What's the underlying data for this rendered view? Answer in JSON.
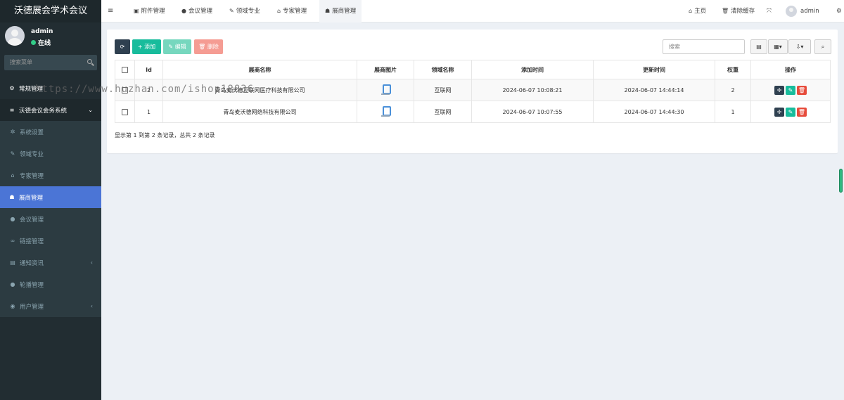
{
  "brand": {
    "title": "沃德展会学术会议"
  },
  "user": {
    "name": "admin",
    "status": "在线"
  },
  "sidebar": {
    "search_placeholder": "搜索菜单",
    "items": [
      {
        "label": "常规管理",
        "icon": "gears-icon",
        "glyph": "⚙",
        "type": "top",
        "arrow": ""
      },
      {
        "label": "沃德会议会务系统",
        "icon": "list-icon",
        "glyph": "≡",
        "type": "head",
        "arrow": "⌄"
      },
      {
        "label": "系统设置",
        "icon": "cog-icon",
        "glyph": "✲",
        "type": "sub",
        "arrow": ""
      },
      {
        "label": "领域专业",
        "icon": "pencil-icon",
        "glyph": "✎",
        "type": "sub",
        "arrow": ""
      },
      {
        "label": "专家管理",
        "icon": "graduation-cap-icon",
        "glyph": "⌂",
        "type": "sub",
        "arrow": ""
      },
      {
        "label": "展商管理",
        "icon": "users-icon",
        "glyph": "☗",
        "type": "active",
        "arrow": ""
      },
      {
        "label": "会议管理",
        "icon": "circle-icon",
        "glyph": "●",
        "type": "sub",
        "arrow": ""
      },
      {
        "label": "链接管理",
        "icon": "link-icon",
        "glyph": "∞",
        "type": "sub",
        "arrow": ""
      },
      {
        "label": "通知资讯",
        "icon": "newspaper-icon",
        "glyph": "▤",
        "type": "sub",
        "arrow": "‹"
      },
      {
        "label": "轮播管理",
        "icon": "circle-icon",
        "glyph": "●",
        "type": "sub",
        "arrow": ""
      },
      {
        "label": "用户管理",
        "icon": "user-circle-icon",
        "glyph": "◉",
        "type": "sub",
        "arrow": "‹"
      }
    ]
  },
  "topbar": {
    "menu_icon": "≡",
    "tabs": [
      {
        "label": "附件管理",
        "icon": "file-image-icon",
        "glyph": "▣"
      },
      {
        "label": "会议管理",
        "icon": "circle-icon",
        "glyph": "●"
      },
      {
        "label": "领域专业",
        "icon": "pencil-icon",
        "glyph": "✎"
      },
      {
        "label": "专家管理",
        "icon": "graduation-cap-icon",
        "glyph": "⌂"
      },
      {
        "label": "展商管理",
        "icon": "users-icon",
        "glyph": "☗"
      }
    ],
    "home": "主页",
    "clear_cache": "清除缓存",
    "user": "admin"
  },
  "toolbar": {
    "refresh": "⟳",
    "add": "添加",
    "edit": "编辑",
    "delete": "删除",
    "search_placeholder": "搜索",
    "colors": {
      "refresh": "#2f4050",
      "add": "#18bc9c",
      "edit": "#76d7be",
      "delete": "#f59c93",
      "op_move": "#2f4050",
      "op_edit": "#18bc9c",
      "op_delete": "#e74c3c"
    }
  },
  "table": {
    "headers": [
      "Id",
      "展商名称",
      "展商图片",
      "领域名称",
      "添加时间",
      "更新时间",
      "权重",
      "操作"
    ],
    "rows": [
      {
        "id": "2",
        "name": "青岛麦沃德互联网医疗科技有限公司",
        "domain": "互联网",
        "added": "2024-06-07 10:08:21",
        "updated": "2024-06-07 14:44:14",
        "weight": "2"
      },
      {
        "id": "1",
        "name": "青岛麦沃德网络科技有限公司",
        "domain": "互联网",
        "added": "2024-06-07 10:07:55",
        "updated": "2024-06-07 14:44:30",
        "weight": "1"
      }
    ],
    "footer": "显示第 1 到第 2 条记录，总共 2 条记录"
  },
  "overlay": {
    "url": "https://www.huzhan.com/ishop18836"
  }
}
